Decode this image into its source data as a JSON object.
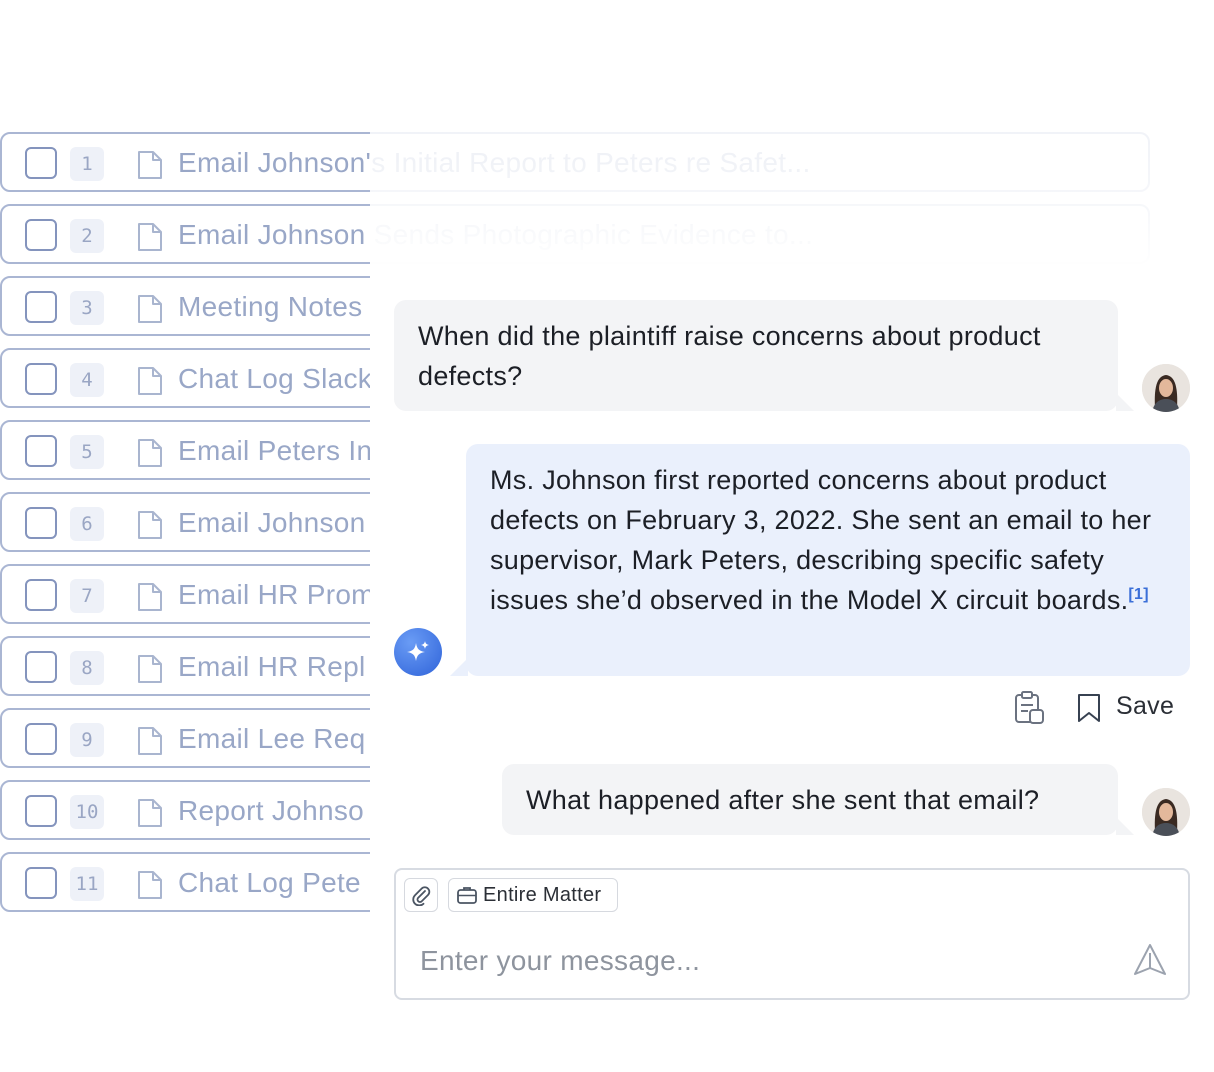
{
  "documents": [
    {
      "num": "1",
      "title": "Email Johnson's Initial Report to Peters re Safet..."
    },
    {
      "num": "2",
      "title": "Email Johnson Sends Photographic Evidence to..."
    },
    {
      "num": "3",
      "title": "Meeting Notes"
    },
    {
      "num": "4",
      "title": "Chat Log Slack"
    },
    {
      "num": "5",
      "title": "Email Peters In"
    },
    {
      "num": "6",
      "title": "Email Johnson"
    },
    {
      "num": "7",
      "title": "Email HR Prom"
    },
    {
      "num": "8",
      "title": "Email HR Repl"
    },
    {
      "num": "9",
      "title": "Email Lee Req"
    },
    {
      "num": "10",
      "title": "Report Johnso"
    },
    {
      "num": "11",
      "title": "Chat Log Pete"
    }
  ],
  "chat": {
    "q1": "When did the plaintiff raise concerns about product defects?",
    "a1": "Ms. Johnson first reported concerns about product defects on February 3, 2022. She sent an email to her supervisor, Mark Peters, describing specific safety issues she’d observed in the Model X circuit boards.",
    "a1_citation": "[1]",
    "save_label": "Save",
    "q2": "What happened after she sent that email?"
  },
  "composer": {
    "scope_label": "Entire Matter",
    "placeholder": "Enter your message..."
  },
  "icons": {
    "file": "file-icon",
    "ai": "sparkle-icon",
    "copy": "clipboard-icon",
    "save": "bookmark-icon",
    "attach": "paperclip-icon",
    "scope": "briefcase-icon",
    "send": "send-icon"
  },
  "colors": {
    "accent": "#3b6fd8",
    "ai_bubble": "#eaf0fc",
    "user_bubble": "#f3f4f6",
    "row_border": "#aab6d3"
  }
}
